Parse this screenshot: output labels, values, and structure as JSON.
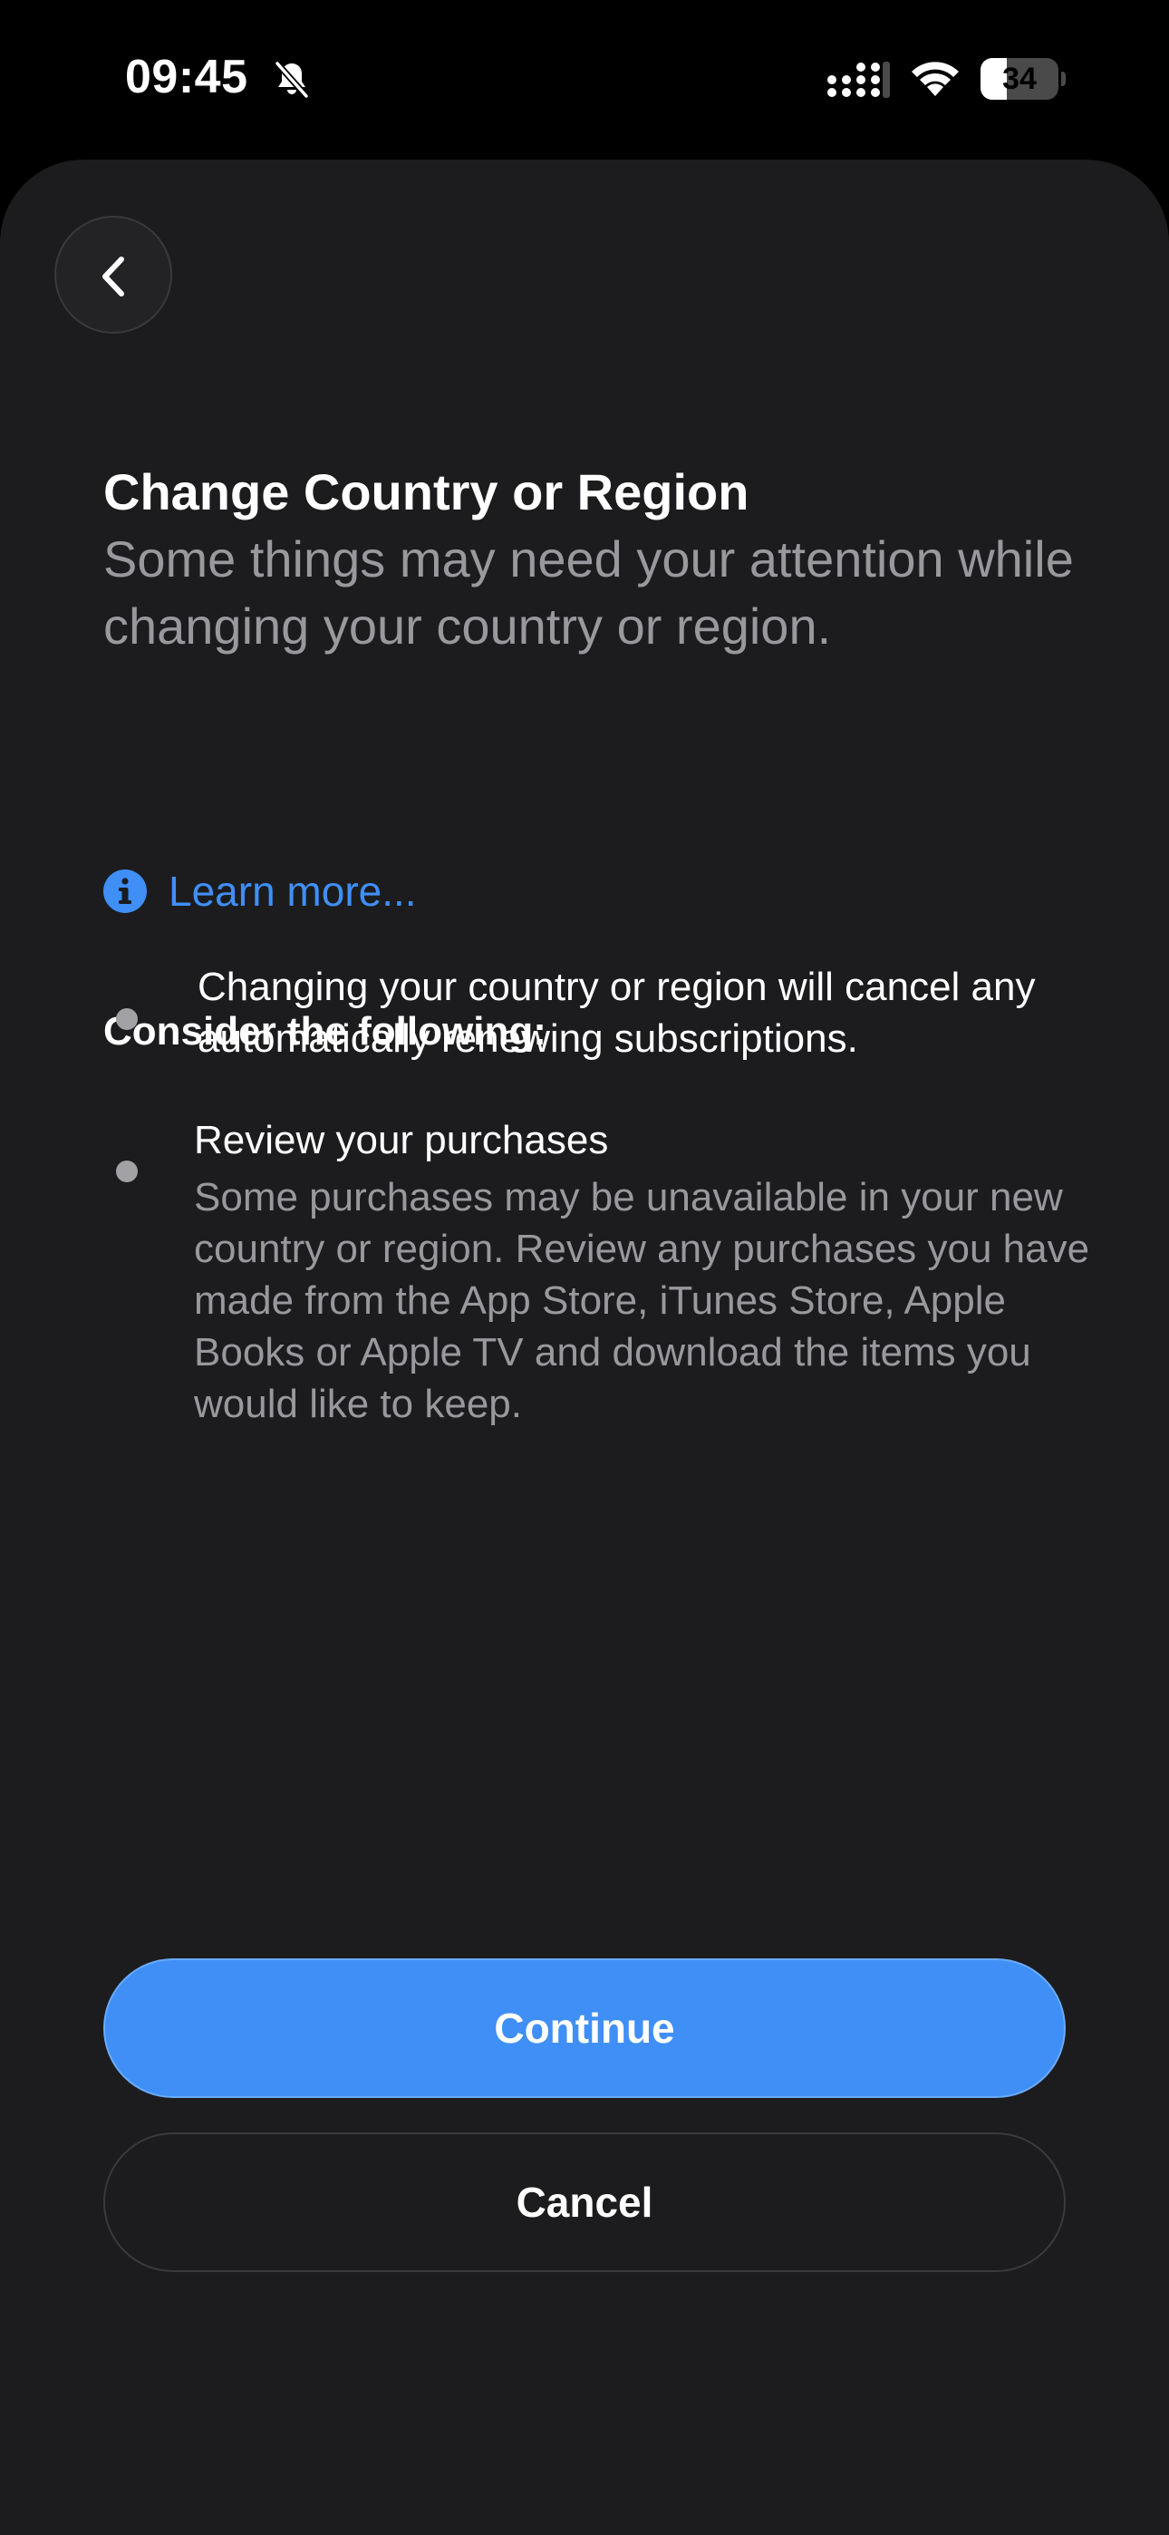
{
  "status_bar": {
    "time": "09:45",
    "silent_icon": "bell-slash-icon",
    "signal_icon": "cellular-signal-icon",
    "wifi_icon": "wifi-icon",
    "battery_percent": "34",
    "battery_level": 0.34
  },
  "nav": {
    "back_icon": "chevron-left-icon"
  },
  "header": {
    "title": "Change Country or Region",
    "subtitle": "Some things may need your attention while changing your country or region."
  },
  "learn_more": {
    "icon": "info-circle-icon",
    "label": "Learn more..."
  },
  "considerations": {
    "heading": "Consider the following:",
    "items": [
      {
        "text": "Changing your country or region will cancel any automatically renewing subscriptions."
      },
      {
        "title": "Review your purchases",
        "description": "Some purchases may be unavailable in your new country or region. Review any purchases you have made from the App Store, iTunes Store, Apple Books or Apple TV and download the items you would like to keep."
      }
    ]
  },
  "actions": {
    "continue_label": "Continue",
    "cancel_label": "Cancel"
  },
  "colors": {
    "background": "#000000",
    "sheet": "#1c1c1e",
    "accent": "#3f8ff6",
    "secondary_text": "#98989d"
  }
}
